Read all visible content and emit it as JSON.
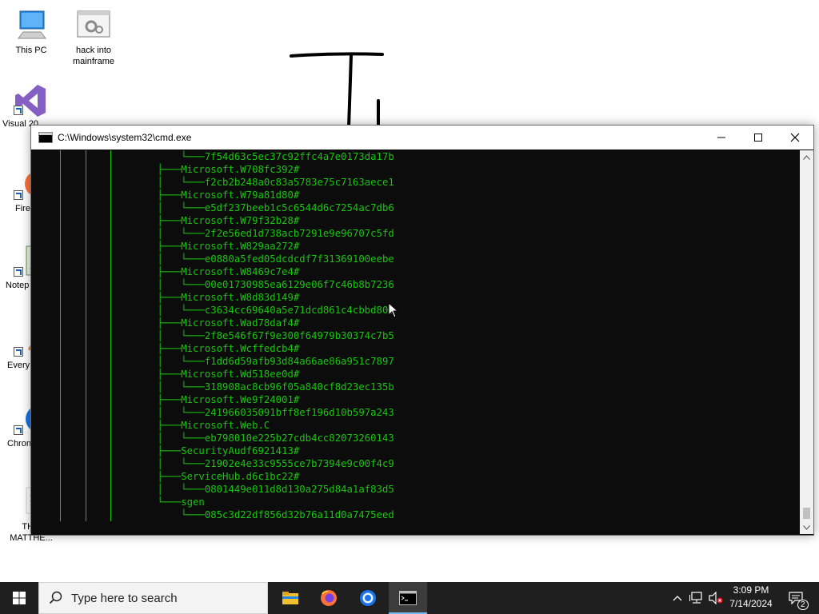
{
  "desktop": {
    "icons": [
      {
        "label": "This PC",
        "icon": "computer-icon"
      },
      {
        "label": "hack into mainframe",
        "icon": "settings-file-icon"
      },
      {
        "label": "Visual 20",
        "icon": "visual-studio-icon"
      },
      {
        "label": "Fire",
        "icon": "firefox-icon"
      },
      {
        "label": "Notep",
        "icon": "notepad-icon"
      },
      {
        "label": "Every",
        "icon": "everything-icon"
      },
      {
        "label": "Chron",
        "icon": "chrome-icon"
      },
      {
        "label": "THO MATTHE...",
        "icon": "document-icon"
      }
    ]
  },
  "cmd": {
    "title": "C:\\Windows\\system32\\cmd.exe",
    "minimize_icon": "minimize-icon",
    "maximize_icon": "maximize-icon",
    "close_icon": "close-icon",
    "text_color": "#16c60c",
    "lines": [
      "        └───7f54d63c5ec37c92ffc4a7e0173da17b",
      "    ├───Microsoft.W708fc392#",
      "    │   └───f2cb2b248a0c83a5783e75c7163aece1",
      "    ├───Microsoft.W79a81d80#",
      "    │   └───e5df237beeb1c5c6544d6c7254ac7db6",
      "    ├───Microsoft.W79f32b28#",
      "    │   └───2f2e56ed1d738acb7291e9e96707c5fd",
      "    ├───Microsoft.W829aa272#",
      "    │   └───e0880a5fed05dcdcdf7f31369100eebe",
      "    ├───Microsoft.W8469c7e4#",
      "    │   └───00e01730985ea6129e06f7c46b8b7236",
      "    ├───Microsoft.W8d83d149#",
      "    │   └───c3634cc69640a5e71dcd861c4cbbd802",
      "    ├───Microsoft.Wad78daf4#",
      "    │   └───2f8e546f67f9e300f64979b30374c7b5",
      "    ├───Microsoft.Wcffedcb4#",
      "    │   └───f1dd6d59afb93d84a66ae86a951c7897",
      "    ├───Microsoft.Wd518ee0d#",
      "    │   └───318908ac8cb96f05a840cf8d23ec135b",
      "    ├───Microsoft.We9f24001#",
      "    │   └───241966035091bff8ef196d10b597a243",
      "    ├───Microsoft.Web.C",
      "    │   └───eb798010e225b27cdb4cc82073260143",
      "    ├───SecurityAudf6921413#",
      "    │   └───21902e4e33c9555ce7b7394e9c00f4c9",
      "    ├───ServiceHub.d6c1bc22#",
      "    │   └───0801449e011d8d130a275d84a1af83d5",
      "    └───sgen",
      "        └───085c3d22df856d32b76a11d0a7475eed"
    ]
  },
  "taskbar": {
    "start_icon": "windows-start-icon",
    "search_placeholder": "Type here to search",
    "pinned": [
      {
        "name": "file-explorer",
        "icon": "folder-icon"
      },
      {
        "name": "firefox",
        "icon": "firefox-icon"
      },
      {
        "name": "chrome",
        "icon": "chrome-icon"
      },
      {
        "name": "cmd",
        "icon": "terminal-icon",
        "active": true
      }
    ],
    "tray": {
      "chevron_icon": "chevron-up-icon",
      "network_icon": "network-icon",
      "volume_icon": "volume-muted-icon"
    },
    "clock": {
      "time": "3:09 PM",
      "date": "7/14/2024"
    },
    "notifications": {
      "icon": "notification-icon",
      "count": "2"
    }
  }
}
